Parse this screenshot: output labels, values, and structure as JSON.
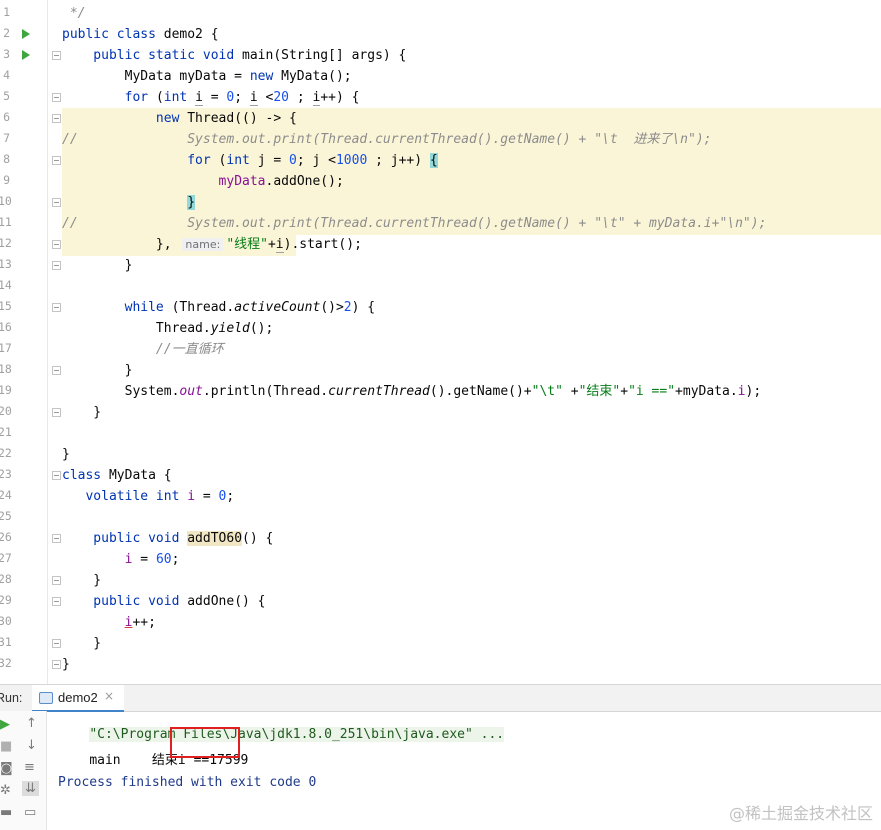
{
  "editor": {
    "lines": [
      {
        "n": "1",
        "parts": [
          {
            "t": " */",
            "c": "cmt"
          }
        ]
      },
      {
        "n": "2",
        "parts": [
          {
            "t": "public class ",
            "c": "kw"
          },
          {
            "t": "demo2 {",
            "c": ""
          }
        ]
      },
      {
        "n": "3",
        "parts": [
          {
            "t": "    public static void ",
            "c": "kw"
          },
          {
            "t": "main(String[] args) {",
            "c": ""
          }
        ]
      },
      {
        "n": "4",
        "parts": [
          {
            "t": "        MyData myData = ",
            "c": ""
          },
          {
            "t": "new ",
            "c": "kw"
          },
          {
            "t": "MyData();",
            "c": ""
          }
        ]
      },
      {
        "n": "5",
        "parts": [
          {
            "t": "        ",
            "c": ""
          },
          {
            "t": "for ",
            "c": "kw"
          },
          {
            "t": "(",
            "c": ""
          },
          {
            "t": "int ",
            "c": "kw"
          },
          {
            "t": "i",
            "c": "underline"
          },
          {
            "t": " = ",
            "c": ""
          },
          {
            "t": "0",
            "c": "num"
          },
          {
            "t": "; ",
            "c": ""
          },
          {
            "t": "i",
            "c": "underline"
          },
          {
            "t": " <",
            "c": ""
          },
          {
            "t": "20",
            "c": "num"
          },
          {
            "t": " ; ",
            "c": ""
          },
          {
            "t": "i",
            "c": "underline"
          },
          {
            "t": "++) {",
            "c": ""
          }
        ]
      },
      {
        "n": "6",
        "parts": [
          {
            "t": "            ",
            "c": ""
          },
          {
            "t": "new ",
            "c": "kw"
          },
          {
            "t": "Thread(() -> {",
            "c": ""
          }
        ]
      },
      {
        "n": "7",
        "parts": [
          {
            "t": "//              System.out.print(Thread.currentThread().getName() + \"\\t  进来了\\n\");",
            "c": "cmt"
          }
        ]
      },
      {
        "n": "8",
        "parts": [
          {
            "t": "                ",
            "c": ""
          },
          {
            "t": "for ",
            "c": "kw"
          },
          {
            "t": "(",
            "c": ""
          },
          {
            "t": "int ",
            "c": "kw"
          },
          {
            "t": "j = ",
            "c": ""
          },
          {
            "t": "0",
            "c": "num"
          },
          {
            "t": "; j <",
            "c": ""
          },
          {
            "t": "1000",
            "c": "num"
          },
          {
            "t": " ; j++) ",
            "c": ""
          },
          {
            "t": "{",
            "c": "brace-hl"
          }
        ]
      },
      {
        "n": "9",
        "parts": [
          {
            "t": "                    ",
            "c": ""
          },
          {
            "t": "myData",
            "c": "fld"
          },
          {
            "t": ".addOne();",
            "c": ""
          }
        ]
      },
      {
        "n": "10",
        "parts": [
          {
            "t": "                ",
            "c": ""
          },
          {
            "t": "}",
            "c": "brace-hl"
          }
        ]
      },
      {
        "n": "11",
        "parts": [
          {
            "t": "//              System.out.print(Thread.currentThread().getName() + \"\\t\" + myData.i+\"\\n\");",
            "c": "cmt"
          }
        ]
      },
      {
        "n": "12",
        "parts": [
          {
            "t": "            }, ",
            "c": ""
          },
          {
            "t": "name:",
            "c": "hint"
          },
          {
            "t": "\"线程\"",
            "c": "str"
          },
          {
            "t": "+",
            "c": ""
          },
          {
            "t": "i",
            "c": "underline"
          },
          {
            "t": ").start();",
            "c": ""
          }
        ]
      },
      {
        "n": "13",
        "parts": [
          {
            "t": "        }",
            "c": ""
          }
        ]
      },
      {
        "n": "14",
        "parts": []
      },
      {
        "n": "15",
        "parts": [
          {
            "t": "        ",
            "c": ""
          },
          {
            "t": "while ",
            "c": "kw"
          },
          {
            "t": "(Thread.",
            "c": ""
          },
          {
            "t": "activeCount",
            "c": "ital"
          },
          {
            "t": "()>",
            "c": ""
          },
          {
            "t": "2",
            "c": "num"
          },
          {
            "t": ") {",
            "c": ""
          }
        ]
      },
      {
        "n": "16",
        "parts": [
          {
            "t": "            Thread.",
            "c": ""
          },
          {
            "t": "yield",
            "c": "ital"
          },
          {
            "t": "();",
            "c": ""
          }
        ]
      },
      {
        "n": "17",
        "parts": [
          {
            "t": "            //一直循环",
            "c": "cmt"
          }
        ]
      },
      {
        "n": "18",
        "parts": [
          {
            "t": "        }",
            "c": ""
          }
        ]
      },
      {
        "n": "19",
        "parts": [
          {
            "t": "        System.",
            "c": ""
          },
          {
            "t": "out",
            "c": "fld ital"
          },
          {
            "t": ".println(Thread.",
            "c": ""
          },
          {
            "t": "currentThread",
            "c": "ital"
          },
          {
            "t": "().getName()+",
            "c": ""
          },
          {
            "t": "\"\\t\"",
            "c": "str"
          },
          {
            "t": " +",
            "c": ""
          },
          {
            "t": "\"结束\"",
            "c": "str"
          },
          {
            "t": "+",
            "c": ""
          },
          {
            "t": "\"i ==\"",
            "c": "str"
          },
          {
            "t": "+myData.",
            "c": ""
          },
          {
            "t": "i",
            "c": "fld"
          },
          {
            "t": ");",
            "c": ""
          }
        ]
      },
      {
        "n": "20",
        "parts": [
          {
            "t": "    }",
            "c": ""
          }
        ]
      },
      {
        "n": "21",
        "parts": []
      },
      {
        "n": "22",
        "parts": [
          {
            "t": "}",
            "c": ""
          }
        ]
      },
      {
        "n": "23",
        "parts": [
          {
            "t": "class ",
            "c": "kw"
          },
          {
            "t": "MyData {",
            "c": ""
          }
        ]
      },
      {
        "n": "24",
        "parts": [
          {
            "t": "   volatile int ",
            "c": "kw"
          },
          {
            "t": "i",
            "c": "fld"
          },
          {
            "t": " = ",
            "c": ""
          },
          {
            "t": "0",
            "c": "num"
          },
          {
            "t": ";",
            "c": ""
          }
        ]
      },
      {
        "n": "25",
        "parts": []
      },
      {
        "n": "26",
        "parts": [
          {
            "t": "    public void ",
            "c": "kw"
          },
          {
            "t": "addTO60",
            "c": "usage-hl"
          },
          {
            "t": "() {",
            "c": ""
          }
        ]
      },
      {
        "n": "27",
        "parts": [
          {
            "t": "        ",
            "c": ""
          },
          {
            "t": "i",
            "c": "fld"
          },
          {
            "t": " = ",
            "c": ""
          },
          {
            "t": "60",
            "c": "num"
          },
          {
            "t": ";",
            "c": ""
          }
        ]
      },
      {
        "n": "28",
        "parts": [
          {
            "t": "    }",
            "c": ""
          }
        ]
      },
      {
        "n": "29",
        "parts": [
          {
            "t": "    public void ",
            "c": "kw"
          },
          {
            "t": "addOne",
            "c": ""
          },
          {
            "t": "() {",
            "c": ""
          }
        ]
      },
      {
        "n": "30",
        "parts": [
          {
            "t": "        ",
            "c": ""
          },
          {
            "t": "i",
            "c": "fld red-underline"
          },
          {
            "t": "++;",
            "c": ""
          }
        ]
      },
      {
        "n": "31",
        "parts": [
          {
            "t": "    }",
            "c": ""
          }
        ]
      },
      {
        "n": "32",
        "parts": [
          {
            "t": "}",
            "c": ""
          }
        ]
      }
    ]
  },
  "run_panel": {
    "label": "Run:",
    "tab_label": "demo2",
    "tab_close": "×",
    "command_line": "\"C:\\Program Files\\Java\\jdk1.8.0_251\\bin\\java.exe\" ...",
    "output_prefix": "main    结束i ==",
    "output_value": "17599",
    "exit_message": "Process finished with exit code 0"
  },
  "watermark": "@稀土掘金技术社区"
}
